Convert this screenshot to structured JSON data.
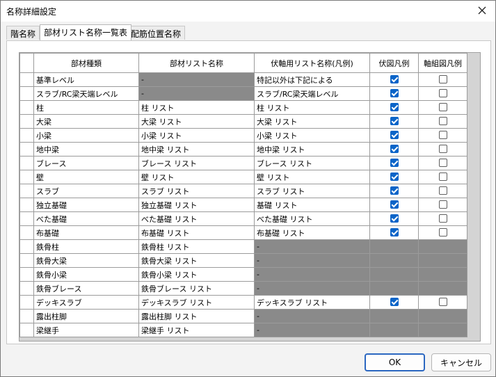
{
  "window": {
    "title": "名称詳細設定"
  },
  "tabs": [
    {
      "label": "階名称",
      "active": false
    },
    {
      "label": "部材リスト名称一覧表",
      "active": true
    },
    {
      "label": "配筋位置名称",
      "active": false
    }
  ],
  "table": {
    "headers": [
      "部材種類",
      "部材リスト名称",
      "伏軸用リスト名称(凡例)",
      "伏図凡例",
      "軸組図凡例"
    ],
    "rows": [
      {
        "type": "基準レベル",
        "list": "-",
        "list_disabled": true,
        "legend": "特記以外は下記による",
        "legend_disabled": false,
        "fuse": true,
        "axis": false
      },
      {
        "type": "スラブ/RC梁天端レベル",
        "list": "-",
        "list_disabled": true,
        "legend": "スラブ/RC梁天端レベル",
        "legend_disabled": false,
        "fuse": true,
        "axis": false
      },
      {
        "type": "柱",
        "list": "柱 リスト",
        "list_disabled": false,
        "legend": "柱 リスト",
        "legend_disabled": false,
        "fuse": true,
        "axis": false
      },
      {
        "type": "大梁",
        "list": "大梁 リスト",
        "list_disabled": false,
        "legend": "大梁 リスト",
        "legend_disabled": false,
        "fuse": true,
        "axis": false
      },
      {
        "type": "小梁",
        "list": "小梁 リスト",
        "list_disabled": false,
        "legend": "小梁 リスト",
        "legend_disabled": false,
        "fuse": true,
        "axis": false
      },
      {
        "type": "地中梁",
        "list": "地中梁 リスト",
        "list_disabled": false,
        "legend": "地中梁 リスト",
        "legend_disabled": false,
        "fuse": true,
        "axis": false
      },
      {
        "type": "ブレース",
        "list": "ブレース リスト",
        "list_disabled": false,
        "legend": "ブレース リスト",
        "legend_disabled": false,
        "fuse": true,
        "axis": false
      },
      {
        "type": "壁",
        "list": "壁 リスト",
        "list_disabled": false,
        "legend": "壁 リスト",
        "legend_disabled": false,
        "fuse": true,
        "axis": false
      },
      {
        "type": "スラブ",
        "list": "スラブ リスト",
        "list_disabled": false,
        "legend": "スラブ リスト",
        "legend_disabled": false,
        "fuse": true,
        "axis": false
      },
      {
        "type": "独立基礎",
        "list": "独立基礎 リスト",
        "list_disabled": false,
        "legend": "基礎 リスト",
        "legend_disabled": false,
        "fuse": true,
        "axis": false
      },
      {
        "type": "べた基礎",
        "list": "べた基礎 リスト",
        "list_disabled": false,
        "legend": "べた基礎 リスト",
        "legend_disabled": false,
        "fuse": true,
        "axis": false
      },
      {
        "type": "布基礎",
        "list": "布基礎 リスト",
        "list_disabled": false,
        "legend": "布基礎 リスト",
        "legend_disabled": false,
        "fuse": true,
        "axis": false
      },
      {
        "type": "鉄骨柱",
        "list": "鉄骨柱 リスト",
        "list_disabled": false,
        "legend": "-",
        "legend_disabled": true,
        "fuse": null,
        "axis": null
      },
      {
        "type": "鉄骨大梁",
        "list": "鉄骨大梁 リスト",
        "list_disabled": false,
        "legend": "-",
        "legend_disabled": true,
        "fuse": null,
        "axis": null
      },
      {
        "type": "鉄骨小梁",
        "list": "鉄骨小梁 リスト",
        "list_disabled": false,
        "legend": "-",
        "legend_disabled": true,
        "fuse": null,
        "axis": null
      },
      {
        "type": "鉄骨ブレース",
        "list": "鉄骨ブレース リスト",
        "list_disabled": false,
        "legend": "-",
        "legend_disabled": true,
        "fuse": null,
        "axis": null
      },
      {
        "type": "デッキスラブ",
        "list": "デッキスラブ リスト",
        "list_disabled": false,
        "legend": "デッキスラブ リスト",
        "legend_disabled": false,
        "fuse": true,
        "axis": false
      },
      {
        "type": "露出柱脚",
        "list": "露出柱脚 リスト",
        "list_disabled": false,
        "legend": "-",
        "legend_disabled": true,
        "fuse": null,
        "axis": null
      },
      {
        "type": "梁継手",
        "list": "梁継手 リスト",
        "list_disabled": false,
        "legend": "-",
        "legend_disabled": true,
        "fuse": null,
        "axis": null
      }
    ]
  },
  "buttons": {
    "ok": "OK",
    "cancel": "キャンセル"
  },
  "colors": {
    "disabled_cell": "#8a8a8a",
    "checkbox_checked": "#0a64c8",
    "ok_border": "#2b67c1"
  }
}
